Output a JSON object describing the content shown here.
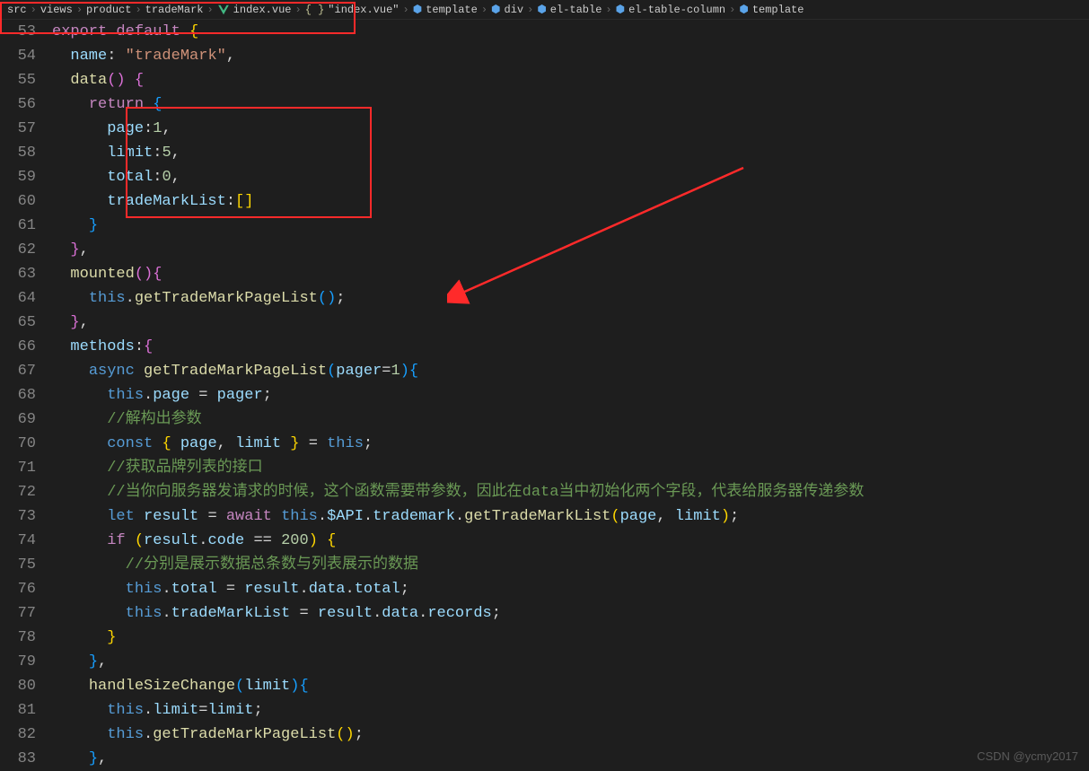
{
  "breadcrumbs": {
    "p0": "src",
    "p1": "views",
    "p2": "product",
    "p3": "tradeMark",
    "p4": "index.vue",
    "p5": "\"index.vue\"",
    "p6": "template",
    "p7": "div",
    "p8": "el-table",
    "p9": "el-table-column",
    "p10": "template"
  },
  "gutter": {
    "start": 53,
    "end": 83
  },
  "code": {
    "l53a": "export",
    "l53b": "default",
    "l53c": "{",
    "l54a": "name",
    "l54b": "\"tradeMark\"",
    "l55a": "data",
    "l55b": "()",
    "l55c": "{",
    "l56a": "return",
    "l56b": "{",
    "l57a": "page",
    "l57b": "1",
    "l58a": "limit",
    "l58b": "5",
    "l59a": "total",
    "l59b": "0",
    "l60a": "tradeMarkList",
    "l60b": "[]",
    "l61a": "}",
    "l62a": "},",
    "l63a": "mounted",
    "l63b": "(){",
    "l64a": "this",
    "l64b": "getTradeMarkPageList",
    "l64c": "();",
    "l65a": "},",
    "l66a": "methods",
    "l66b": ":{",
    "l67a": "async",
    "l67b": "getTradeMarkPageList",
    "l67c": "(",
    "l67d": "pager",
    "l67e": "=",
    "l67f": "1",
    "l67g": "){",
    "l68a": "this",
    "l68b": "page",
    "l68c": "pager",
    "l69a": "//解构出参数",
    "l70a": "const",
    "l70b": "{",
    "l70c": "page",
    "l70d": "limit",
    "l70e": "}",
    "l70f": "this",
    "l71a": "//获取品牌列表的接口",
    "l72a": "//当你向服务器发请求的时候，这个函数需要带参数，因此在data当中初始化两个字段，代表给服务器传递参数",
    "l73a": "let",
    "l73b": "result",
    "l73c": "await",
    "l73d": "this",
    "l73e": "$API",
    "l73f": "trademark",
    "l73g": "getTradeMarkList",
    "l73h": "page",
    "l73i": "limit",
    "l74a": "if",
    "l74b": "result",
    "l74c": "code",
    "l74d": "200",
    "l75a": "//分别是展示数据总条数与列表展示的数据",
    "l76a": "this",
    "l76b": "total",
    "l76c": "result",
    "l76d": "data",
    "l76e": "total",
    "l77a": "this",
    "l77b": "tradeMarkList",
    "l77c": "result",
    "l77d": "data",
    "l77e": "records",
    "l78a": "}",
    "l79a": "},",
    "l80a": "handleSizeChange",
    "l80b": "limit",
    "l81a": "this",
    "l81b": "limit",
    "l81c": "limit",
    "l82a": "this",
    "l82b": "getTradeMarkPageList",
    "l83a": "},"
  },
  "watermark": "CSDN @ycmy2017"
}
